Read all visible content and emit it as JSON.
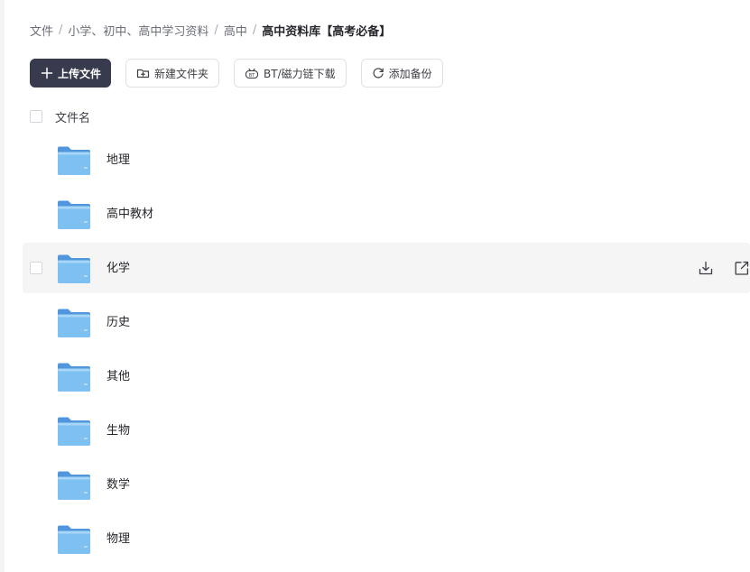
{
  "breadcrumb": {
    "items": [
      "文件",
      "小学、初中、高中学习资料",
      "高中"
    ],
    "current": "高中资料库【高考必备】",
    "separator": "/"
  },
  "toolbar": {
    "upload_label": "上传文件",
    "new_folder_label": "新建文件夹",
    "bt_label": "BT/磁力链下载",
    "backup_label": "添加备份"
  },
  "list": {
    "column_header": "文件名",
    "items": [
      {
        "name": "地理",
        "icon": "folder-icon"
      },
      {
        "name": "高中教材",
        "icon": "folder-icon"
      },
      {
        "name": "化学",
        "icon": "folder-icon"
      },
      {
        "name": "历史",
        "icon": "folder-icon"
      },
      {
        "name": "其他",
        "icon": "folder-icon"
      },
      {
        "name": "生物",
        "icon": "folder-icon"
      },
      {
        "name": "数学",
        "icon": "folder-icon"
      },
      {
        "name": "物理",
        "icon": "folder-icon"
      }
    ],
    "hovered_index": 2
  },
  "colors": {
    "primary_button": "#383a4d",
    "folder": "#6aaee8",
    "hover_row": "#f5f5f6"
  }
}
